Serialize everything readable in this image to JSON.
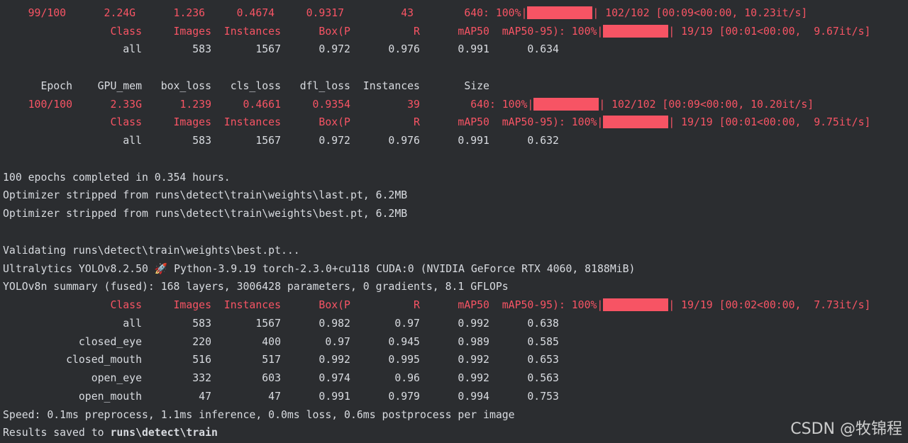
{
  "epoch99": {
    "epoch": "    99/100",
    "values": "      2.24G      1.236     0.4674     0.9317         43        640: 100%|",
    "progress": "| 102/102 [00:09<00:00, 10.23it/s]",
    "progress_fraction": 1.0
  },
  "val99": {
    "header": "                 Class     Images  Instances      Box(P          R      mAP50  mAP50-95): 100%|",
    "progress": "| 19/19 [00:01<00:00,  9.67it/s]",
    "progress_fraction": 1.0,
    "all_row": "                   all        583       1567      0.972      0.976      0.991      0.634"
  },
  "train_header": "      Epoch    GPU_mem   box_loss   cls_loss   dfl_loss  Instances       Size",
  "epoch100": {
    "epoch": "    100/100",
    "values": "      2.33G      1.239     0.4661     0.9354         39        640: 100%|",
    "progress": "| 102/102 [00:09<00:00, 10.20it/s]",
    "progress_fraction": 1.0
  },
  "val100": {
    "header": "                 Class     Images  Instances      Box(P          R      mAP50  mAP50-95): 100%|",
    "progress": "| 19/19 [00:01<00:00,  9.75it/s]",
    "progress_fraction": 1.0,
    "all_row": "                   all        583       1567      0.972      0.976      0.991      0.632"
  },
  "summary_lines": [
    "100 epochs completed in 0.354 hours.",
    "Optimizer stripped from runs\\detect\\train\\weights\\last.pt, 6.2MB",
    "Optimizer stripped from runs\\detect\\train\\weights\\best.pt, 6.2MB"
  ],
  "validating_line": "Validating runs\\detect\\train\\weights\\best.pt...",
  "ultralytics_line": "Ultralytics YOLOv8.2.50 🚀 Python-3.9.19 torch-2.3.0+cu118 CUDA:0 (NVIDIA GeForce RTX 4060, 8188MiB)",
  "model_summary_line": "YOLOv8n summary (fused): 168 layers, 3006428 parameters, 0 gradients, 8.1 GFLOPs",
  "final_val": {
    "header": "                 Class     Images  Instances      Box(P          R      mAP50  mAP50-95): 100%|",
    "progress": "| 19/19 [00:02<00:00,  7.73it/s]",
    "progress_fraction": 1.0,
    "rows": [
      "                   all        583       1567      0.982       0.97      0.992      0.638",
      "            closed_eye        220        400       0.97      0.945      0.989      0.585",
      "          closed_mouth        516        517      0.992      0.995      0.992      0.653",
      "              open_eye        332        603      0.974       0.96      0.992      0.563",
      "            open_mouth         47         47      0.991      0.979      0.994      0.753"
    ]
  },
  "speed_line": "Speed: 0.1ms preprocess, 1.1ms inference, 0.0ms loss, 0.6ms postprocess per image",
  "results_prefix": "Results saved to ",
  "results_path": "runs\\detect\\train",
  "watermark": "CSDN @牧锦程",
  "colors": {
    "background": "#2b2d30",
    "text": "#d8dbe0",
    "accent_red": "#f75464"
  }
}
